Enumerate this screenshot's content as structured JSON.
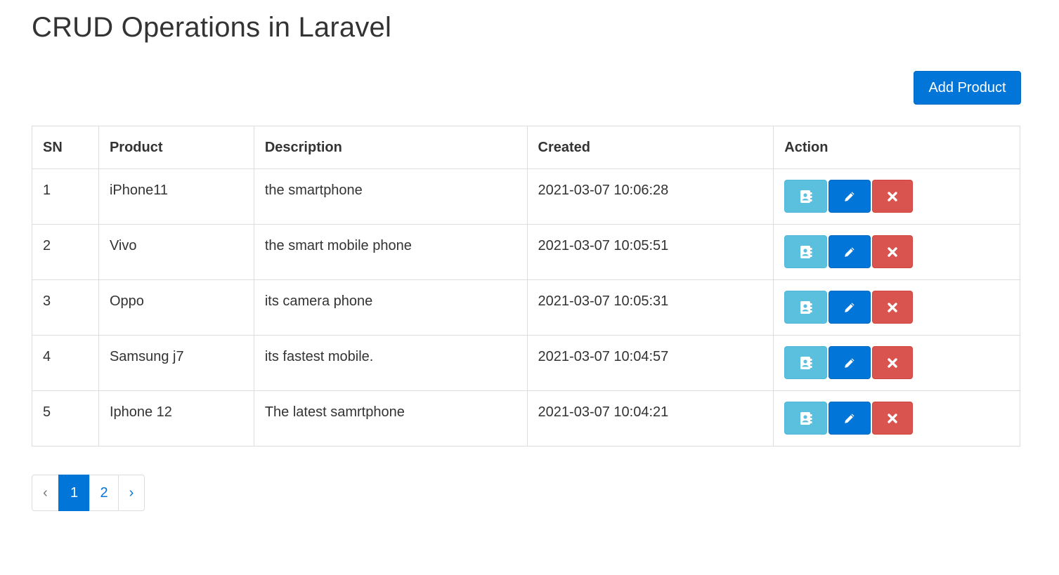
{
  "header": {
    "title": "CRUD Operations in Laravel"
  },
  "toolbar": {
    "add_label": "Add Product"
  },
  "table": {
    "columns": [
      "SN",
      "Product",
      "Description",
      "Created",
      "Action"
    ],
    "rows": [
      {
        "sn": "1",
        "product": "iPhone11",
        "description": "the smartphone",
        "created": "2021-03-07 10:06:28"
      },
      {
        "sn": "2",
        "product": "Vivo",
        "description": "the smart mobile phone",
        "created": "2021-03-07 10:05:51"
      },
      {
        "sn": "3",
        "product": "Oppo",
        "description": "its camera phone",
        "created": "2021-03-07 10:05:31"
      },
      {
        "sn": "4",
        "product": "Samsung j7",
        "description": "its fastest mobile.",
        "created": "2021-03-07 10:04:57"
      },
      {
        "sn": "5",
        "product": "Iphone 12",
        "description": "The latest samrtphone",
        "created": "2021-03-07 10:04:21"
      }
    ],
    "action_icons": [
      "contact-book-icon",
      "pencil-icon",
      "close-icon"
    ]
  },
  "pagination": {
    "prev": "‹",
    "pages": [
      "1",
      "2"
    ],
    "current": "1",
    "next": "›"
  },
  "colors": {
    "primary": "#0275d8",
    "info": "#5bc0de",
    "danger": "#d9534f",
    "border": "#dddddd"
  }
}
